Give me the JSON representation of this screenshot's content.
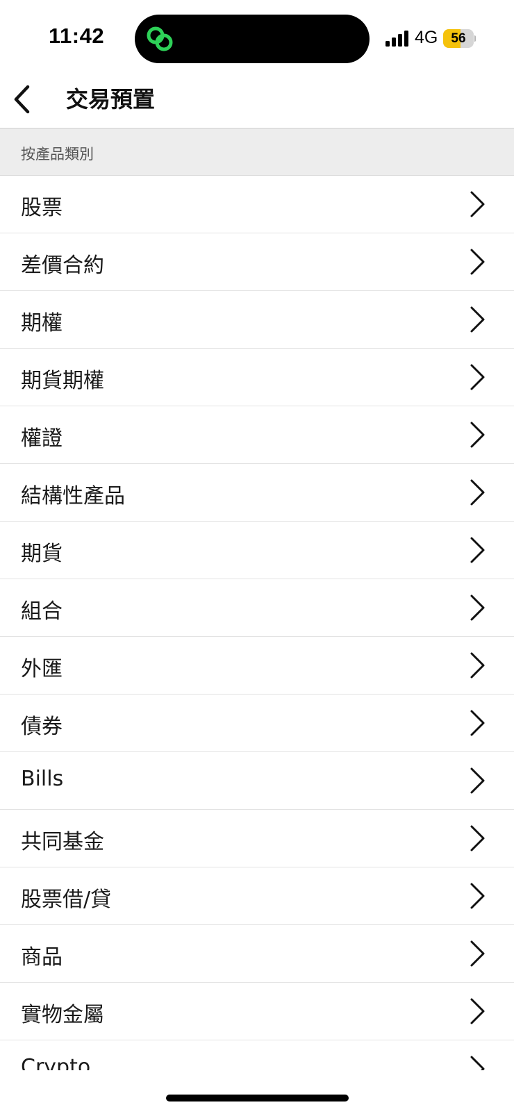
{
  "status_bar": {
    "time": "11:42",
    "network": "4G",
    "battery_level": "56",
    "battery_fraction": 0.56,
    "battery_color": "#f5c20c",
    "signal_bars": 4,
    "island_icon": "green-link-icon",
    "island_icon_color": "#2ed158"
  },
  "header": {
    "title": "交易預置",
    "back_icon": "chevron-left-icon"
  },
  "section": {
    "title": "按產品類別"
  },
  "items": [
    {
      "label": "股票"
    },
    {
      "label": "差價合約"
    },
    {
      "label": "期權"
    },
    {
      "label": "期貨期權"
    },
    {
      "label": "權證"
    },
    {
      "label": "結構性產品"
    },
    {
      "label": "期貨"
    },
    {
      "label": "組合"
    },
    {
      "label": "外匯"
    },
    {
      "label": "債券"
    },
    {
      "label": "Bills"
    },
    {
      "label": "共同基金"
    },
    {
      "label": "股票借/貸"
    },
    {
      "label": "商品"
    },
    {
      "label": "實物金屬"
    },
    {
      "label": "Crypto"
    }
  ]
}
